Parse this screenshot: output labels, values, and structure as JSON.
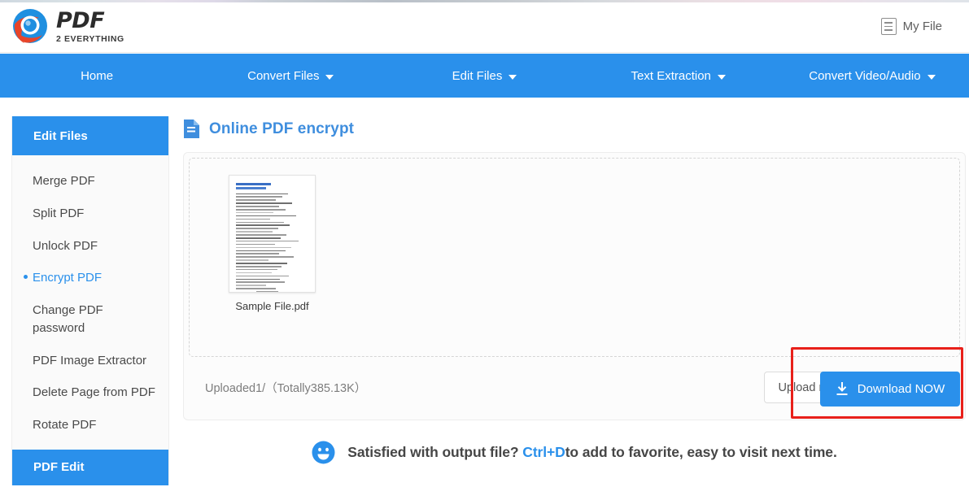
{
  "header": {
    "logo_primary": "PDF",
    "logo_secondary": "2 EVERYTHING",
    "my_file_label": "My File",
    "my_file_icon": "list-document-icon"
  },
  "nav": {
    "items": [
      {
        "label": "Home",
        "has_caret": false
      },
      {
        "label": "Convert Files",
        "has_caret": true
      },
      {
        "label": "Edit Files",
        "has_caret": true
      },
      {
        "label": "Text Extraction",
        "has_caret": true
      },
      {
        "label": "Convert Video/Audio",
        "has_caret": true
      }
    ]
  },
  "sidebar": {
    "header_label": "Edit Files",
    "footer_label": "PDF Edit",
    "items": [
      {
        "label": "Merge PDF",
        "active": false
      },
      {
        "label": "Split PDF",
        "active": false
      },
      {
        "label": "Unlock PDF",
        "active": false
      },
      {
        "label": "Encrypt PDF",
        "active": true
      },
      {
        "label": "Change PDF password",
        "active": false
      },
      {
        "label": "PDF Image Extractor",
        "active": false
      },
      {
        "label": "Delete Page from PDF",
        "active": false
      },
      {
        "label": "Rotate PDF",
        "active": false
      }
    ]
  },
  "main": {
    "page_title": "Online PDF encrypt",
    "page_title_icon": "document-icon",
    "file": {
      "name": "Sample File.pdf"
    },
    "uploaded_status": "Uploaded1/（Totally385.13K）",
    "upload_more_label": "Upload more",
    "download_label": "Download NOW",
    "download_icon": "download-icon"
  },
  "footer_note": {
    "icon": "smiley-face-icon",
    "text_before": "Satisfied with output file?",
    "shortcut": "Ctrl+D",
    "text_after": "to add to favorite, easy to visit next time."
  },
  "colors": {
    "brand_blue": "#2a90eb",
    "title_blue": "#3f8ede",
    "annotation_red": "#e8201a",
    "logo_red": "#e8452a"
  }
}
